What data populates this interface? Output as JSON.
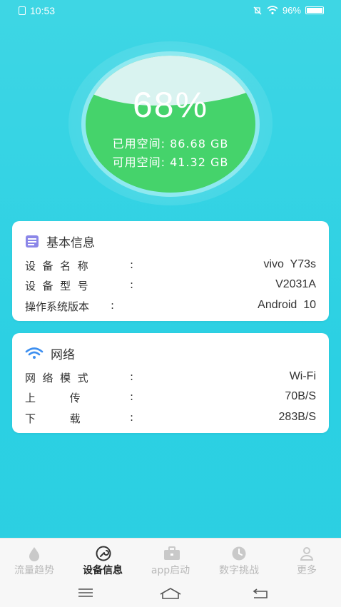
{
  "status": {
    "time": "10:53",
    "battery_text": "96%",
    "icons": [
      "sim-icon",
      "mute-icon",
      "wifi-icon",
      "battery-icon"
    ]
  },
  "gauge": {
    "percent_text": "68%",
    "used_label": "已用空间: 86.68 GB",
    "free_label": "可用空间: 41.32 GB",
    "fill_fraction": 0.68,
    "colors": {
      "fill": "#45d36b",
      "ring": "#8fe9f0",
      "wave": "#d9f3f0"
    }
  },
  "card_basic": {
    "title": "基本信息",
    "icon": "document-icon",
    "rows": [
      {
        "label": "设  备  名  称",
        "colon": ":",
        "value": "vivo  Y73s"
      },
      {
        "label": "设  备  型  号",
        "colon": ":",
        "value": "V2031A"
      },
      {
        "label": "操作系统版本",
        "colon": ":",
        "value": "Android  10"
      }
    ]
  },
  "card_network": {
    "title": "网络",
    "icon": "wifi-icon",
    "rows": [
      {
        "label": "网  络  模  式",
        "colon": ":",
        "value": "Wi-Fi"
      },
      {
        "label": "上          传",
        "colon": ":",
        "value": "70B/S"
      },
      {
        "label": "下          载",
        "colon": ":",
        "value": "283B/S"
      }
    ]
  },
  "nav": {
    "tabs": [
      {
        "label": "流量趋势",
        "icon": "drop-icon",
        "active": false
      },
      {
        "label": "设备信息",
        "icon": "wrench-icon",
        "active": true
      },
      {
        "label": "app启动",
        "icon": "briefcase-icon",
        "active": false
      },
      {
        "label": "数字挑战",
        "icon": "clock-icon",
        "active": false
      },
      {
        "label": "更多",
        "icon": "person-icon",
        "active": false
      }
    ],
    "active_color": "#222222",
    "inactive_color": "#b9b9b9"
  }
}
